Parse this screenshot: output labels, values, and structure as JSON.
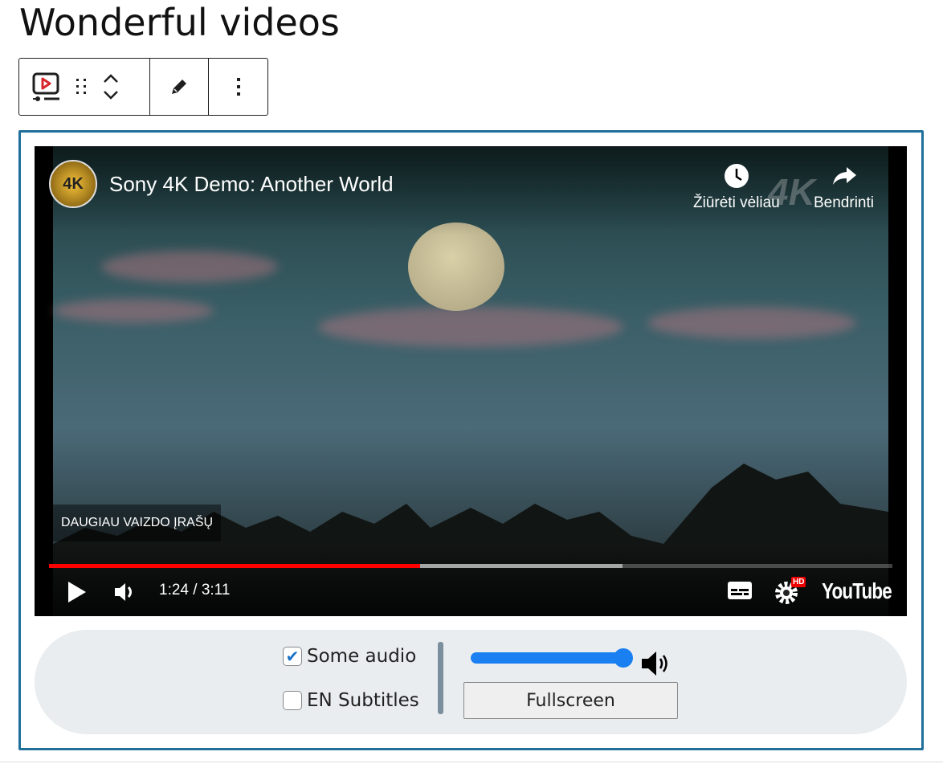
{
  "page_title": "Wonderful videos",
  "toolbar": {
    "block_type": "video-block-icon",
    "drag": "drag-handle-icon",
    "move": "move-up-down-icon",
    "edit": "pencil-icon",
    "options": "more-vertical-icon"
  },
  "video": {
    "title": "Sony 4K Demo: Another World",
    "channel_badge": "4K",
    "watch_later": "Žiūrėti vėliau",
    "share": "Bendrinti",
    "watermark": "4K",
    "more_videos": "DAUGIAU VAIZDO ĮRAŠŲ",
    "time": "1:24 / 3:11",
    "progress_percent": 44,
    "buffered_percent": 68,
    "hd_badge": "HD",
    "logo": "YouTube",
    "accent": "#ff0000"
  },
  "controls": {
    "audio_label": "Some audio",
    "audio_checked": true,
    "subtitles_label": "EN Subtitles",
    "subtitles_checked": false,
    "volume_percent": 100,
    "fullscreen_label": "Fullscreen",
    "accent": "#1a7ff0"
  }
}
